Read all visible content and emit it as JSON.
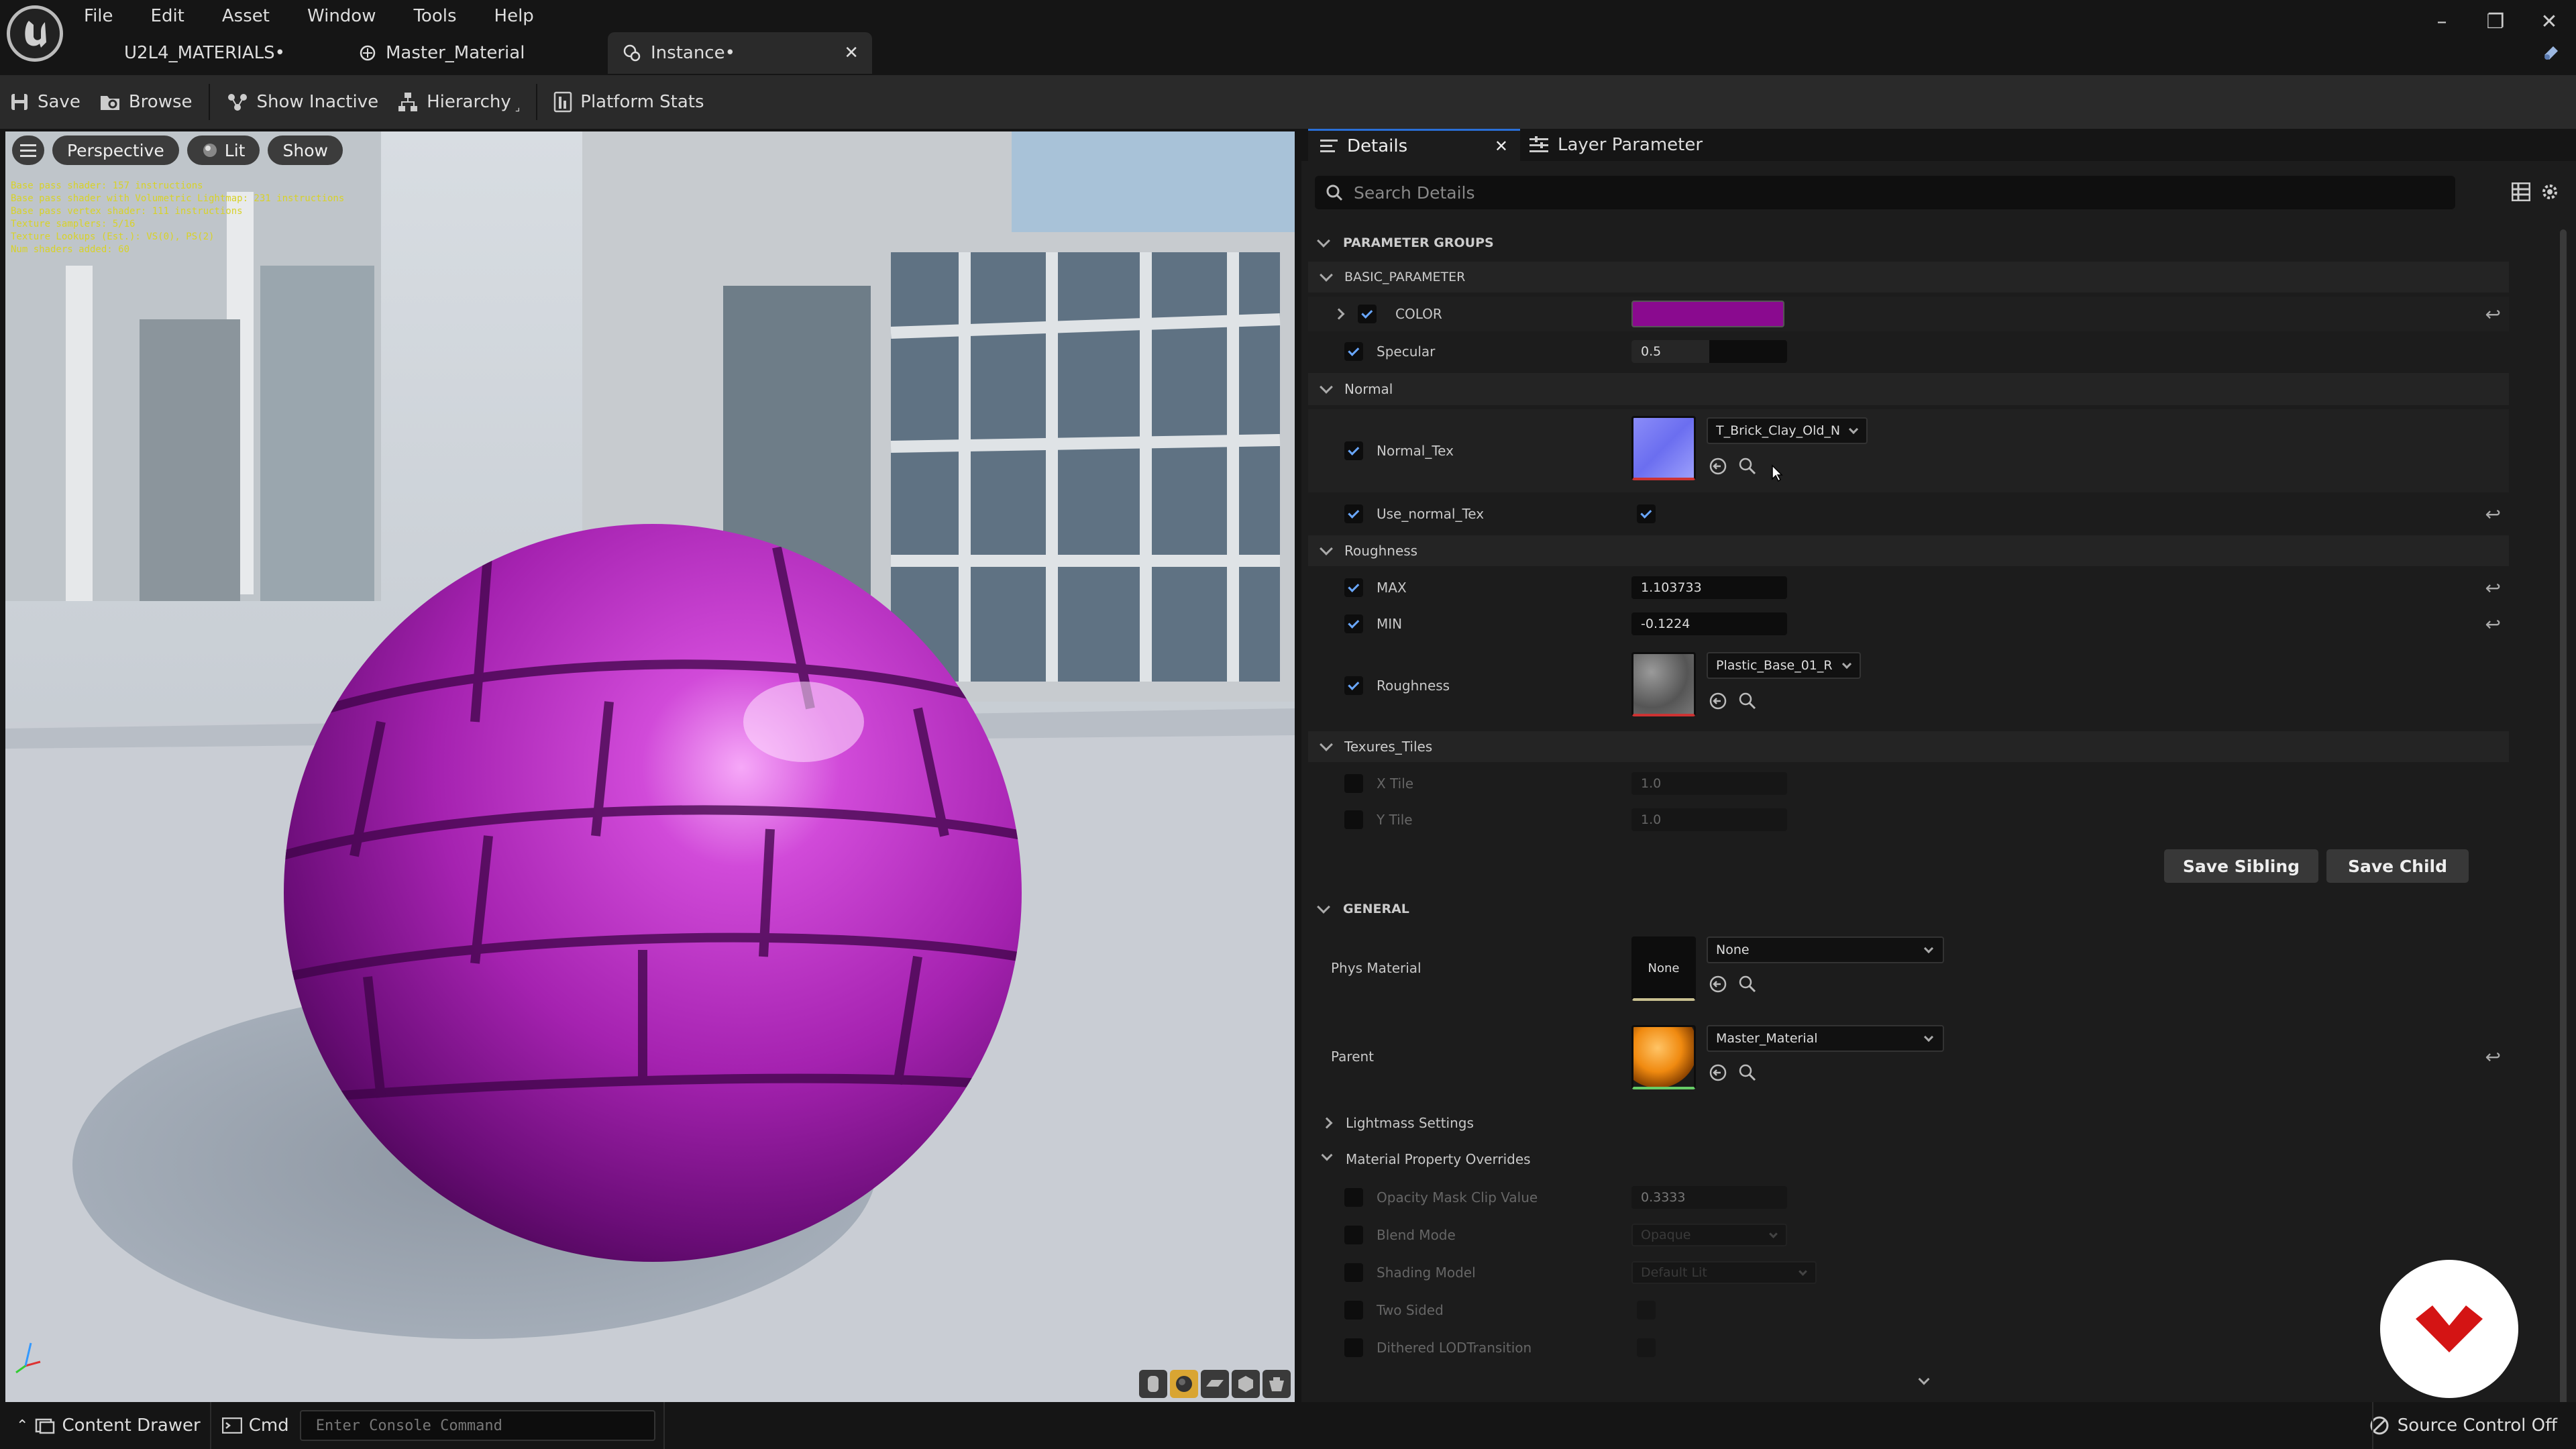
{
  "menu": [
    "File",
    "Edit",
    "Asset",
    "Window",
    "Tools",
    "Help"
  ],
  "tabs": {
    "project": "U2L4_MATERIALS•",
    "master": "Master_Material",
    "instance": "Instance•"
  },
  "toolbar": {
    "save": "Save",
    "browse": "Browse",
    "show_inactive": "Show Inactive",
    "hierarchy": "Hierarchy",
    "platform_stats": "Platform Stats"
  },
  "viewport": {
    "perspective": "Perspective",
    "lit": "Lit",
    "show": "Show",
    "stats": [
      "Base pass shader: 157 instructions",
      "Base pass shader with Volumetric Lightmap: 231 instructions",
      "Base pass vertex shader: 111 instructions",
      "Texture samplers: 5/16",
      "Texture Lookups (Est.): VS(0), PS(2)",
      "Num shaders added: 60"
    ]
  },
  "details": {
    "tab_details": "Details",
    "tab_layer": "Layer Parameter",
    "search_placeholder": "Search Details",
    "parameter_groups": "PARAMETER GROUPS",
    "basic_parameter": "BASIC_PARAMETER",
    "color_label": "COLOR",
    "color_value": "#8a0a8f",
    "specular_label": "Specular",
    "specular_value": "0.5",
    "specular_fraction": 0.5,
    "normal_group": "Normal",
    "normal_tex_label": "Normal_Tex",
    "normal_tex_value": "T_Brick_Clay_Old_N",
    "use_normal_label": "Use_normal_Tex",
    "roughness_group": "Roughness",
    "max_label": "MAX",
    "max_value": "1.103733",
    "min_label": "MIN",
    "min_value": "-0.1224",
    "roughness_label": "Roughness",
    "roughness_tex_value": "Plastic_Base_01_R",
    "tiles_group": "Texures_Tiles",
    "xtile_label": "X Tile",
    "xtile_value": "1.0",
    "ytile_label": "Y Tile",
    "ytile_value": "1.0",
    "save_sibling": "Save Sibling",
    "save_child": "Save Child",
    "general": "GENERAL",
    "phys_label": "Phys Material",
    "phys_thumb": "None",
    "phys_value": "None",
    "parent_label": "Parent",
    "parent_value": "Master_Material",
    "lightmass": "Lightmass Settings",
    "overrides": "Material Property Overrides",
    "opacity_label": "Opacity Mask Clip Value",
    "opacity_value": "0.3333",
    "blend_label": "Blend Mode",
    "blend_value": "Opaque",
    "shading_label": "Shading Model",
    "shading_value": "Default Lit",
    "two_sided_label": "Two Sided",
    "dithered_label": "Dithered LODTransition"
  },
  "status": {
    "content_drawer": "Content Drawer",
    "cmd": "Cmd",
    "console_placeholder": "Enter Console Command",
    "source_control": "Source Control Off"
  }
}
